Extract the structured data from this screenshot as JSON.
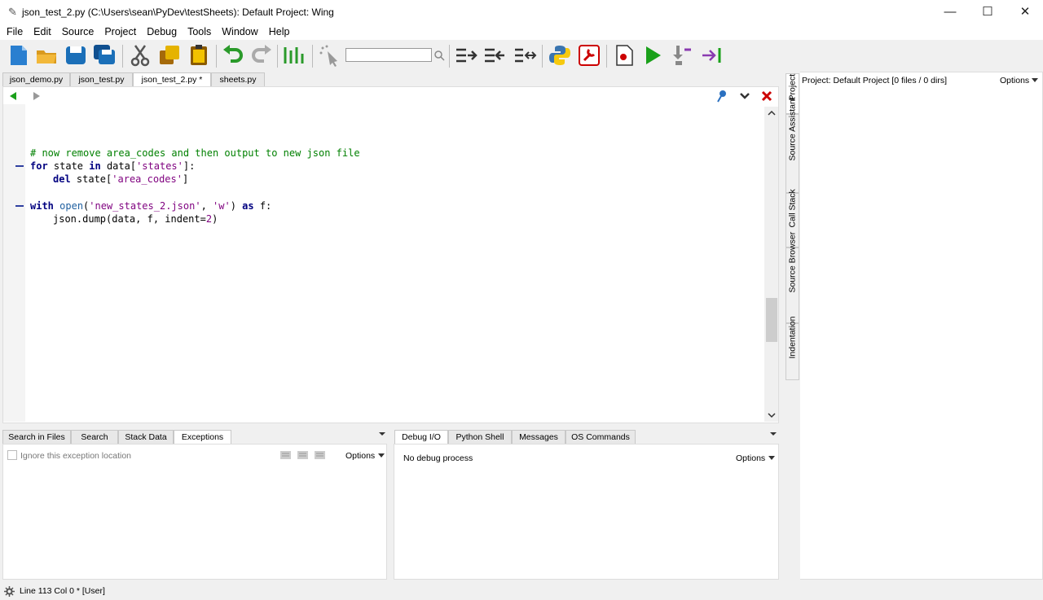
{
  "window": {
    "title": "json_test_2.py (C:\\Users\\sean\\PyDev\\testSheets): Default Project: Wing",
    "minimize": "—",
    "maximize": "☐",
    "close": "✕"
  },
  "menu": [
    "File",
    "Edit",
    "Source",
    "Project",
    "Debug",
    "Tools",
    "Window",
    "Help"
  ],
  "toolbar": {
    "search_value": ""
  },
  "editor_tabs": [
    "json_demo.py",
    "json_test.py",
    "json_test_2.py *",
    "sheets.py"
  ],
  "code": {
    "line1": "# now remove area_codes and then output to new json file",
    "line2_kw1": "for",
    "line2_a": " state ",
    "line2_kw2": "in",
    "line2_b": " data[",
    "line2_str": "'states'",
    "line2_c": "]:",
    "line3_kw": "del",
    "line3_a": " state[",
    "line3_str": "'area_codes'",
    "line3_b": "]",
    "line5_kw1": "with",
    "line5_fn": "open",
    "line5_a": "(",
    "line5_str1": "'new_states_2.json'",
    "line5_b": ", ",
    "line5_str2": "'w'",
    "line5_c": ") ",
    "line5_kw2": "as",
    "line5_d": " f:",
    "line6_a": "json.dump(data, f, indent=",
    "line6_num": "2",
    "line6_b": ")"
  },
  "bottom_left_tabs": [
    "Search in Files",
    "Search",
    "Stack Data",
    "Exceptions"
  ],
  "bottom_right_tabs": [
    "Debug I/O",
    "Python Shell",
    "Messages",
    "OS Commands"
  ],
  "exceptions": {
    "ignore_label": "Ignore this exception location",
    "options": "Options"
  },
  "debug_io": {
    "status": "No debug process",
    "options": "Options"
  },
  "right_panel": {
    "header": "Project: Default Project [0 files / 0 dirs]",
    "options": "Options"
  },
  "side_tabs": [
    "Project",
    "Source Assistant",
    "Call Stack",
    "Source Browser",
    "Indentation"
  ],
  "status_bar": {
    "text": "Line 113 Col 0 * [User]"
  }
}
